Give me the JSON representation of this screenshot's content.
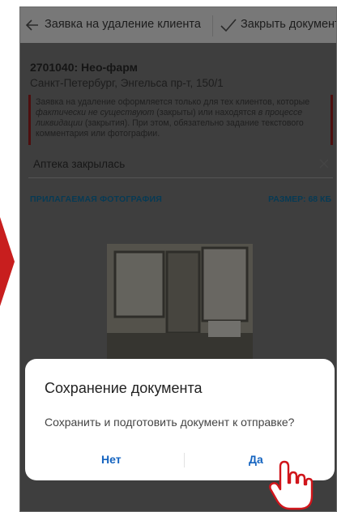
{
  "topbar": {
    "title": "Заявка на удаление клиента",
    "close_label": "Закрыть документ"
  },
  "client": {
    "code_name": "2701040: Нео-фарм",
    "address": "Санкт-Петербург, Энгельса пр-т, 150/1"
  },
  "notice": {
    "part1": "Заявка на удаление оформляется только для тех клиентов, которые ",
    "italic1": "фактически не существуют",
    "part2": " (закрыты) или находятся ",
    "italic2": "в процессе ликвидации",
    "part3": " (закрытия). При этом, обязательно задание текстового комментария или фотографии."
  },
  "comment": {
    "value": "Аптека закрылась"
  },
  "photo_section": {
    "label": "ПРИЛАГАЕМАЯ ФОТОГРАФИЯ",
    "size_label": "РАЗМЕР: 68 КБ"
  },
  "dialog": {
    "title": "Сохранение документа",
    "message": "Сохранить и подготовить документ к отправке?",
    "no_label": "Нет",
    "yes_label": "Да"
  },
  "colors": {
    "accent": "#1564c0",
    "link_blue": "#0f74a8",
    "warning_bar": "#9a1d1d",
    "arrow_red": "#c81e1e"
  }
}
